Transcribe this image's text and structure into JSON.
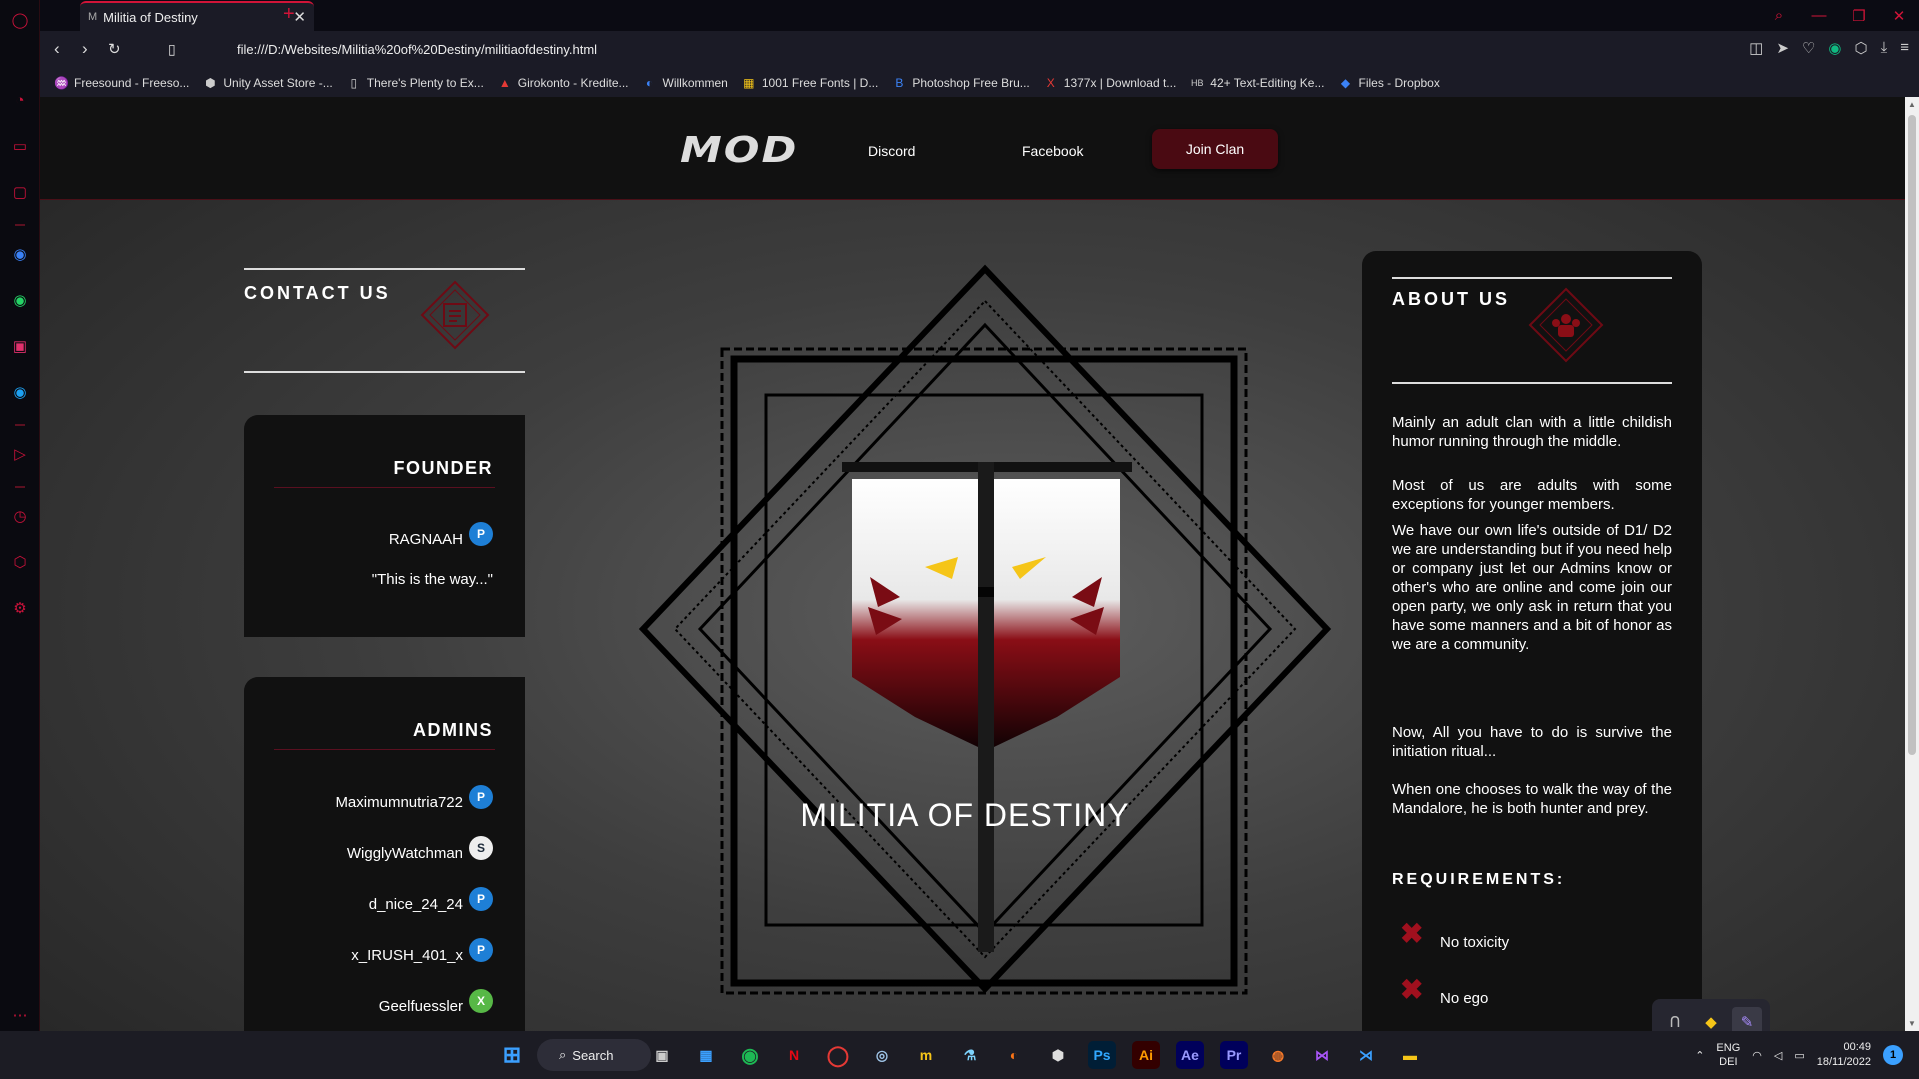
{
  "browser": {
    "tab_title": "Militia of Destiny",
    "tab_favicon": "M",
    "url": "file:///D:/Websites/Militia%20of%20Destiny/militiaofdestiny.html",
    "bookmarks": [
      {
        "label": "Freesound - Freeso...",
        "icon": "waveform-icon"
      },
      {
        "label": "Unity Asset Store -...",
        "icon": "unity-icon"
      },
      {
        "label": "There's Plenty to Ex...",
        "icon": "page-icon"
      },
      {
        "label": "Girokonto - Kredite...",
        "icon": "bank-icon"
      },
      {
        "label": "Willkommen",
        "icon": "globe-icon"
      },
      {
        "label": "1001 Free Fonts | D...",
        "icon": "fonts-icon"
      },
      {
        "label": "Photoshop Free Bru...",
        "icon": "brush-icon"
      },
      {
        "label": "1377x | Download t...",
        "icon": "x-icon"
      },
      {
        "label": "42+ Text-Editing Ke...",
        "icon": "hb-icon"
      },
      {
        "label": "Files - Dropbox",
        "icon": "dropbox-icon"
      }
    ]
  },
  "site": {
    "logo": "MOD",
    "nav": {
      "discord": "Discord",
      "facebook": "Facebook",
      "join": "Join Clan"
    },
    "contact_title": "CONTACT US",
    "founder": {
      "title": "FOUNDER",
      "name": "RAGNAAH",
      "platform": "playstation",
      "quote": "\"This is the way...\""
    },
    "admins": {
      "title": "ADMINS",
      "members": [
        {
          "name": "Maximumnutria722",
          "platform": "playstation"
        },
        {
          "name": "WigglyWatchman",
          "platform": "steam"
        },
        {
          "name": "d_nice_24_24",
          "platform": "playstation"
        },
        {
          "name": "x_IRUSH_401_x",
          "platform": "playstation"
        },
        {
          "name": "Geelfuessler",
          "platform": "xbox"
        }
      ]
    },
    "emblem_title": "MILITIA OF DESTINY",
    "about": {
      "title": "ABOUT US",
      "paragraphs": [
        "Mainly an adult clan with a little childish humor running through the middle.",
        "Most of us are adults with some exceptions for younger members.",
        "We have our own life's outside of D1/ D2 we are understanding but if you need help or company just let our Admins know or other's who are online and come join our open party, we only ask in return that you have some manners and a bit of honor as we are a community.",
        "Now, All you have to do is survive the initiation ritual...",
        "When one chooses to walk the way of the Mandalore, he is both hunter and prey."
      ],
      "requirements_title": "REQUIREMENTS:",
      "requirements": [
        "No toxicity",
        "No ego"
      ]
    }
  },
  "taskbar": {
    "search_label": "Search",
    "language": "ENG",
    "keyboard": "DEI",
    "time": "00:49",
    "date": "18/11/2022",
    "notifications": "1"
  },
  "colors": {
    "accent": "#d11438",
    "brand_dark_red": "#4a0a12",
    "card_bg": "#111111"
  }
}
